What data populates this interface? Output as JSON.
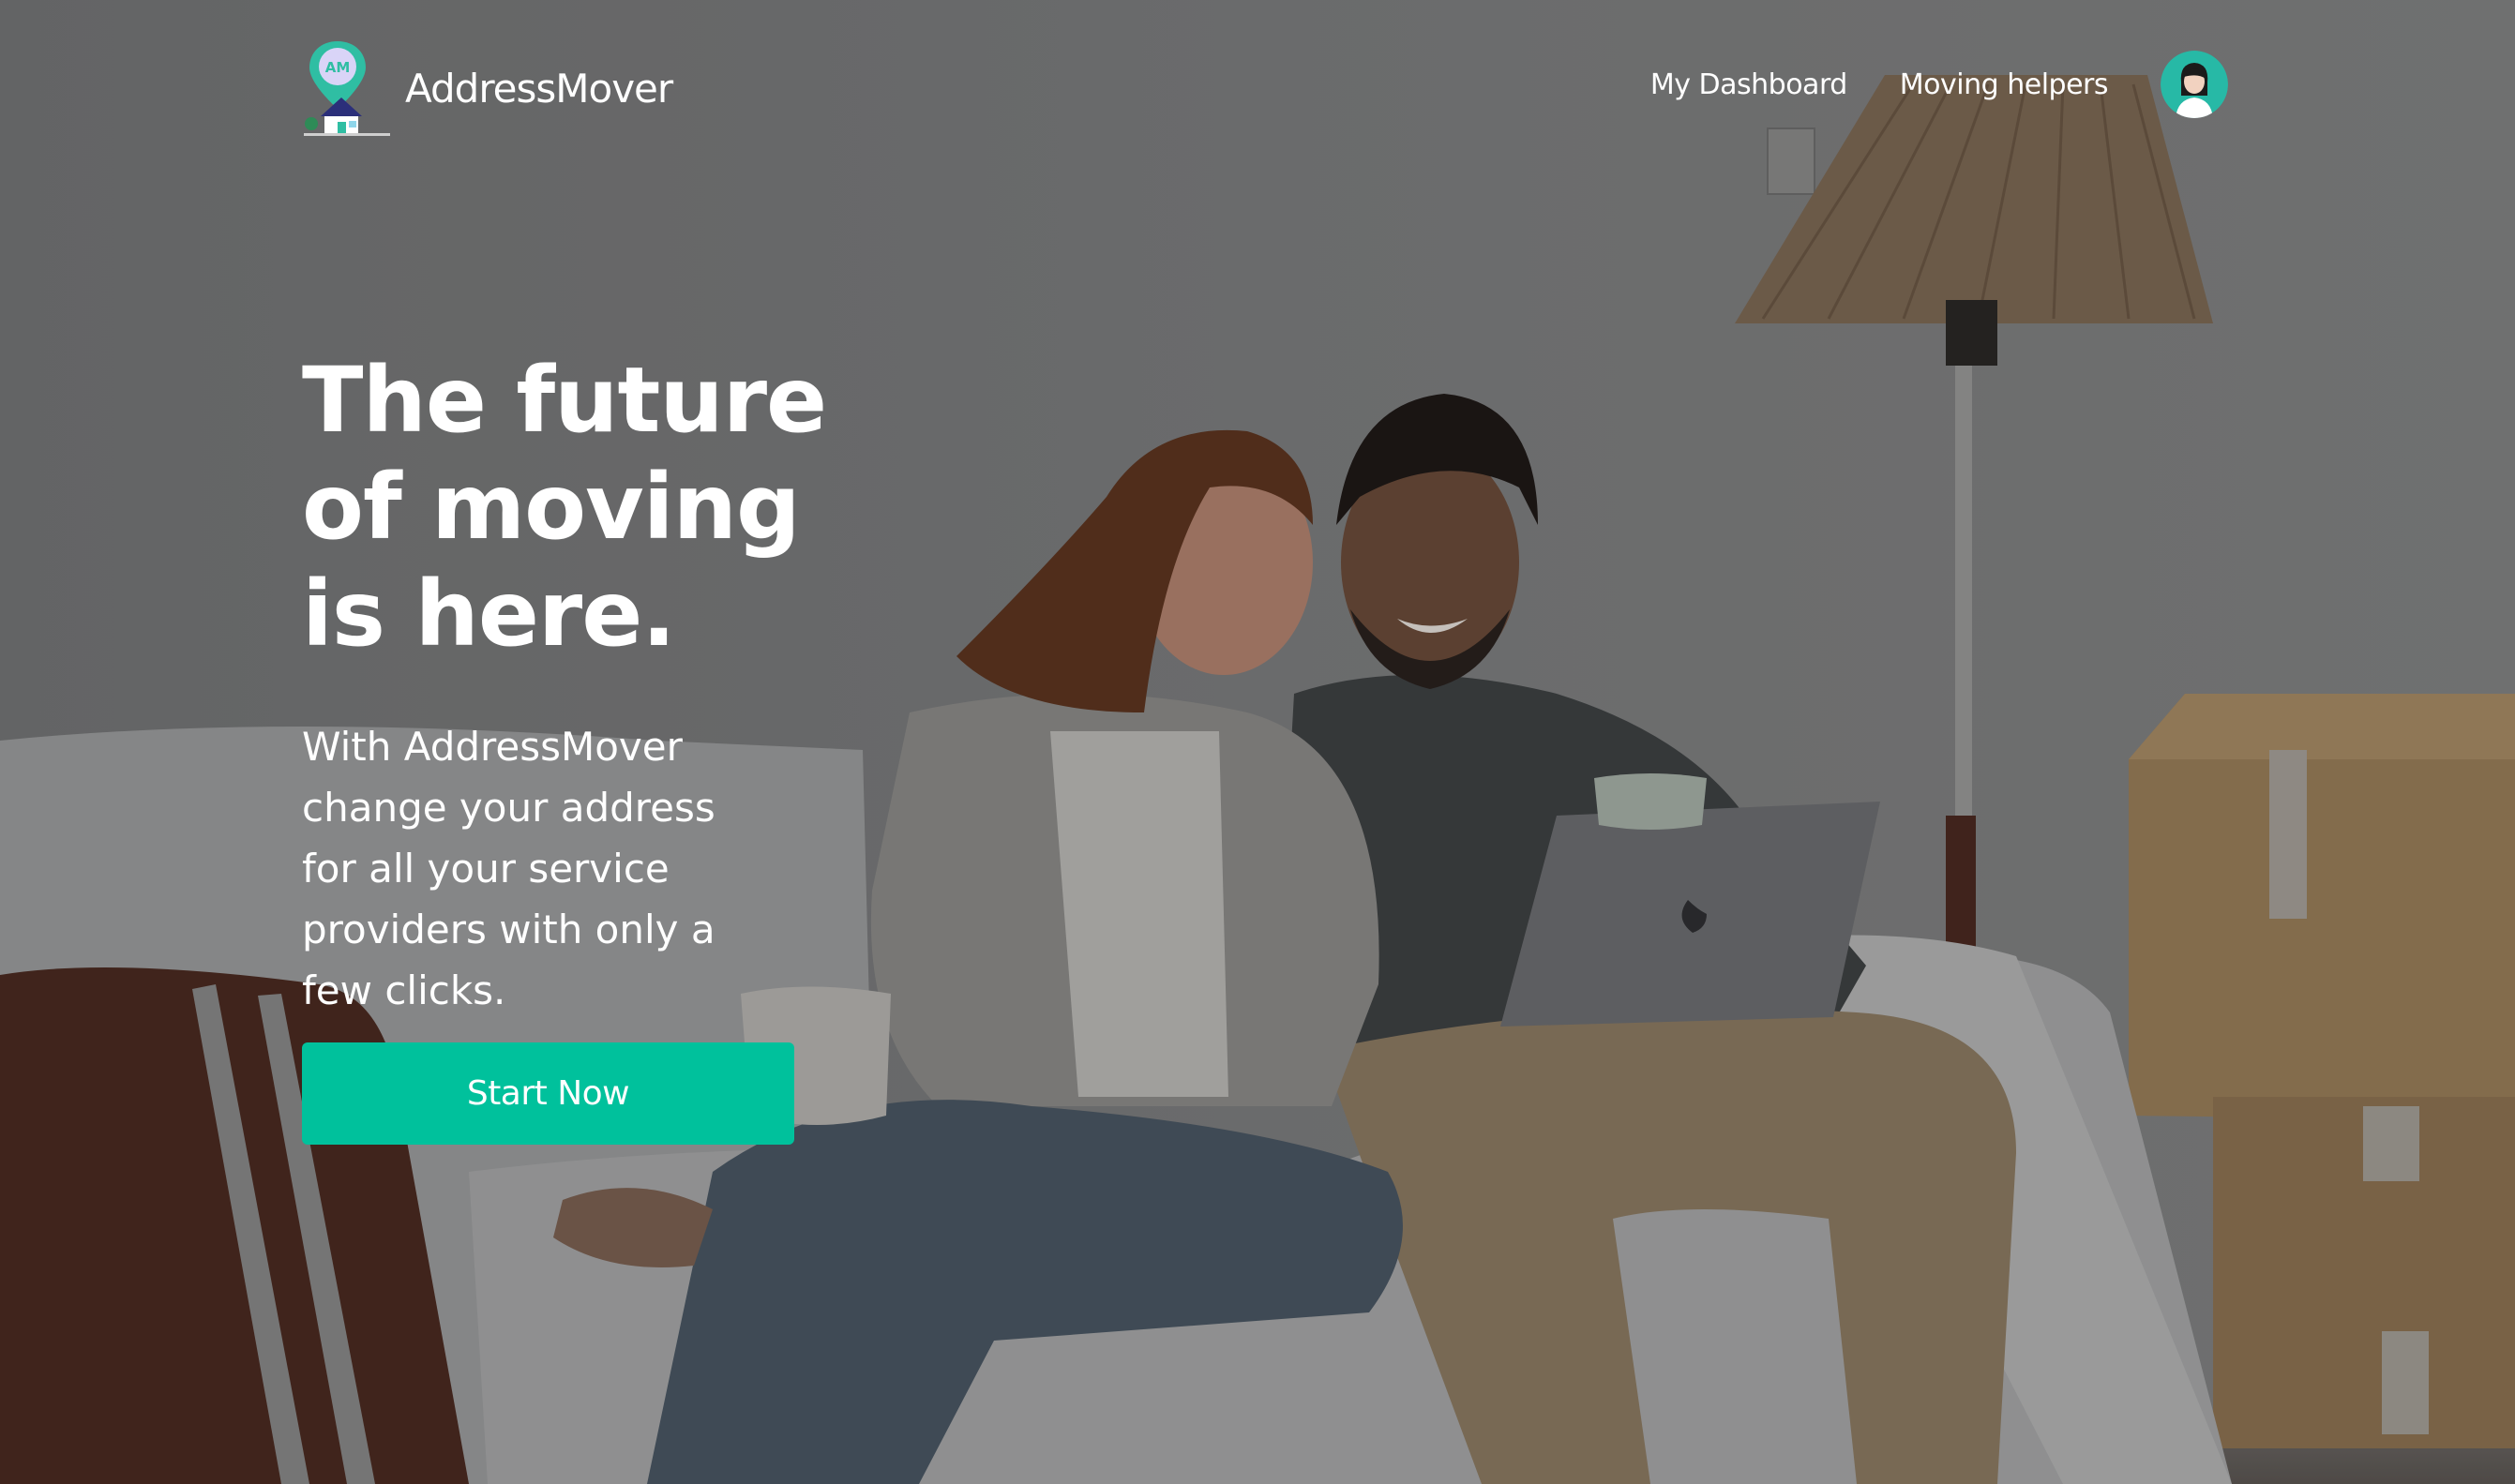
{
  "brand": {
    "name": "AddressMover",
    "logo_initials": "AM",
    "accent_color": "#00c19c"
  },
  "nav": {
    "items": [
      {
        "label": "My Dashboard"
      },
      {
        "label": "Moving helpers"
      }
    ],
    "avatar_icon": "user-avatar-icon"
  },
  "hero": {
    "title_lines": [
      "The future",
      "of moving",
      "is here."
    ],
    "subtitle_lines": [
      "With AddressMover",
      "change your address",
      "for all your service",
      "providers with only a",
      "few clicks."
    ],
    "cta_label": "Start Now"
  }
}
